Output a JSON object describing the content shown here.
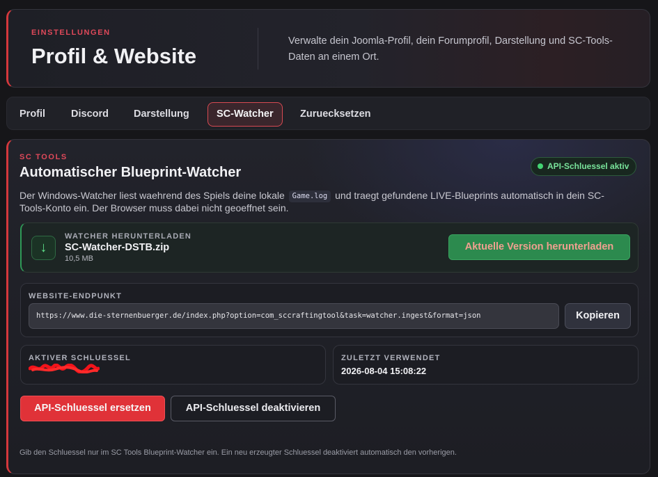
{
  "header": {
    "eyebrow": "EINSTELLUNGEN",
    "title": "Profil & Website",
    "description": "Verwalte dein Joomla-Profil, dein Forumprofil, Darstellung und SC-Tools-Daten an einem Ort."
  },
  "tabs": [
    {
      "label": "Profil"
    },
    {
      "label": "Discord"
    },
    {
      "label": "Darstellung"
    },
    {
      "label": "SC-Watcher",
      "active": true
    },
    {
      "label": "Zuruecksetzen"
    }
  ],
  "section": {
    "eyebrow": "SC TOOLS",
    "title": "Automatischer Blueprint-Watcher",
    "badge": "API-Schluessel aktiv",
    "intro_before": "Der Windows-Watcher liest waehrend des Spiels deine lokale",
    "intro_code": "Game.log",
    "intro_after": "und traegt gefundene LIVE-Blueprints automatisch in dein SC-Tools-Konto ein. Der Browser muss dabei nicht geoeffnet sein."
  },
  "download": {
    "eyebrow": "WATCHER HERUNTERLADEN",
    "filename": "SC-Watcher-DSTB.zip",
    "size": "10,5 MB",
    "button": "Aktuelle Version herunterladen"
  },
  "endpoint": {
    "label": "WEBSITE-ENDPUNKT",
    "url": "https://www.die-sternenbuerger.de/index.php?option=com_sccraftingtool&task=watcher.ingest&format=json",
    "copy_button": "Kopieren"
  },
  "active_key": {
    "label": "AKTIVER SCHLUESSEL"
  },
  "last_used": {
    "label": "ZULETZT VERWENDET",
    "value": "2026-08-04 15:08:22"
  },
  "actions": {
    "replace": "API-Schluessel ersetzen",
    "deactivate": "API-Schluessel deaktivieren"
  },
  "footnote": "Gib den Schluessel nur im SC Tools Blueprint-Watcher ein. Ein neu erzeugter Schluessel deaktiviert automatisch den vorherigen.",
  "colors": {
    "accent_red": "#d5383c",
    "success_green": "#2c8a4e",
    "badge_green": "#79e39b"
  }
}
